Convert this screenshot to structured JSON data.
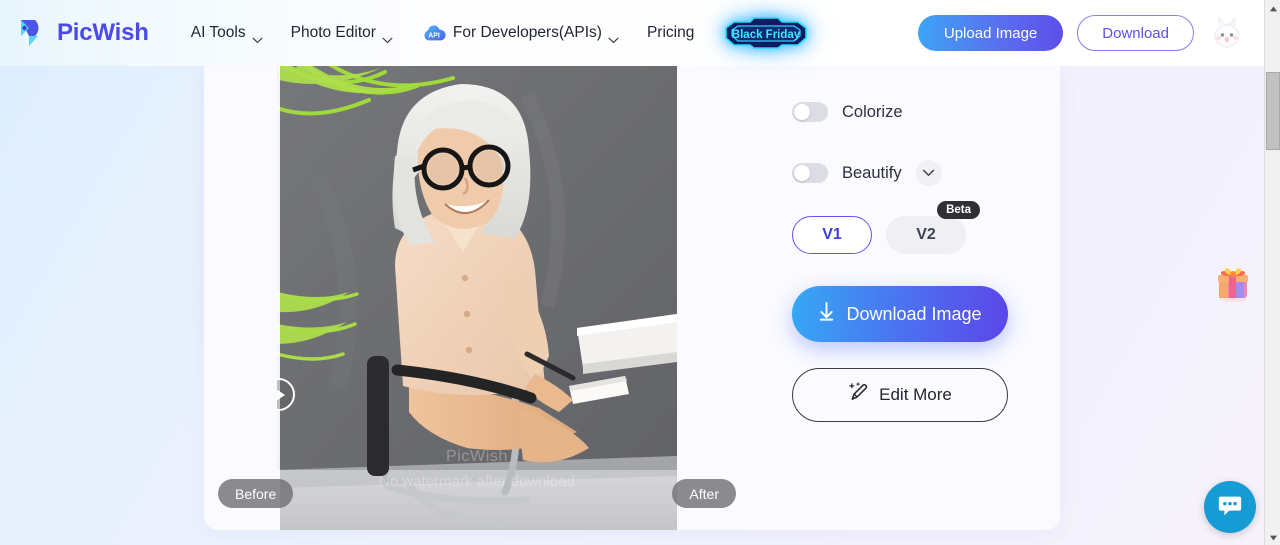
{
  "header": {
    "logo_text": "PicWish",
    "logo_icon": "picwish-bird-logo",
    "nav": [
      {
        "label": "AI Tools",
        "icon": "chevron-down-icon",
        "has_chevron": true
      },
      {
        "label": "Photo Editor",
        "icon": "chevron-down-icon",
        "has_chevron": true
      },
      {
        "label": "For Developers(APIs)",
        "icon": "api-cloud-icon",
        "has_chevron": true
      },
      {
        "label": "Pricing",
        "has_chevron": false
      }
    ],
    "promo_badge": "Black Friday",
    "upload_label": "Upload Image",
    "download_label": "Download",
    "avatar_icon": "bunny-avatar-icon"
  },
  "editor": {
    "before_label": "Before",
    "after_label": "After",
    "watermark_title": "PicWish",
    "watermark_subtitle": "No watermark after download",
    "slider_handle_icon": "slider-arrow-icon"
  },
  "controls": {
    "colorize_label": "Colorize",
    "colorize_on": false,
    "beautify_label": "Beautify",
    "beautify_on": false,
    "beautify_expand_icon": "chevron-down-icon",
    "version_v1": "V1",
    "version_v2": "V2",
    "version_selected": "V1",
    "beta_tag": "Beta",
    "download_image_label": "Download Image",
    "download_icon": "download-arrow-icon",
    "edit_more_label": "Edit More",
    "edit_icon": "magic-pencil-icon"
  },
  "floating": {
    "gift_icon": "gift-box-icon",
    "chat_icon": "chat-bubble-icon"
  },
  "colors": {
    "brand_purple": "#4b49e8",
    "accent_blue": "#3da4f6",
    "gradient_start": "#36a8f4",
    "gradient_end": "#5c46e8",
    "neon_cyan": "#27d6ff",
    "chat_blue": "#169bd5"
  }
}
